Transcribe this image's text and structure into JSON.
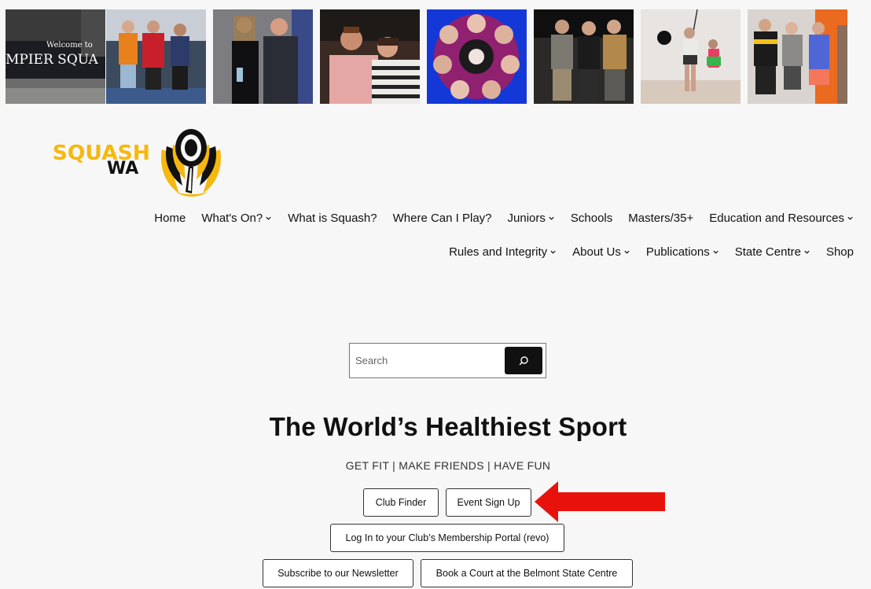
{
  "photos": [
    {
      "id": "photo-1",
      "sign_small": "Welcome to",
      "sign_big": "MPIER SQUA"
    },
    {
      "id": "photo-2"
    },
    {
      "id": "photo-3"
    },
    {
      "id": "photo-4"
    },
    {
      "id": "photo-5"
    },
    {
      "id": "photo-6"
    },
    {
      "id": "photo-7"
    },
    {
      "id": "photo-8"
    }
  ],
  "logo": {
    "line1": "SQUASH",
    "line2": "WA"
  },
  "nav": {
    "row1": [
      {
        "label": "Home",
        "dropdown": false
      },
      {
        "label": "What's On?",
        "dropdown": true
      },
      {
        "label": "What is Squash?",
        "dropdown": false
      },
      {
        "label": "Where Can I Play?",
        "dropdown": false
      },
      {
        "label": "Juniors",
        "dropdown": true
      },
      {
        "label": "Schools",
        "dropdown": false
      },
      {
        "label": "Masters/35+",
        "dropdown": false
      },
      {
        "label": "Education and Resources",
        "dropdown": true
      }
    ],
    "row2": [
      {
        "label": "Rules and Integrity",
        "dropdown": true
      },
      {
        "label": "About Us",
        "dropdown": true
      },
      {
        "label": "Publications",
        "dropdown": true
      },
      {
        "label": "State Centre",
        "dropdown": true
      },
      {
        "label": "Shop",
        "dropdown": false
      }
    ]
  },
  "search": {
    "placeholder": "Search",
    "value": ""
  },
  "hero": {
    "title": "The World’s Healthiest Sport",
    "subtitle": "GET FIT | MAKE FRIENDS | HAVE FUN"
  },
  "buttons": {
    "club_finder": "Club Finder",
    "event_signup": "Event Sign Up",
    "login_portal": "Log In to your Club’s Membership Portal (revo)",
    "newsletter": "Subscribe to our Newsletter",
    "book_court": "Book a Court at the Belmont State Centre"
  },
  "colors": {
    "brand_yellow": "#f6b80e",
    "arrow_red": "#e8120c",
    "search_button": "#111111"
  }
}
